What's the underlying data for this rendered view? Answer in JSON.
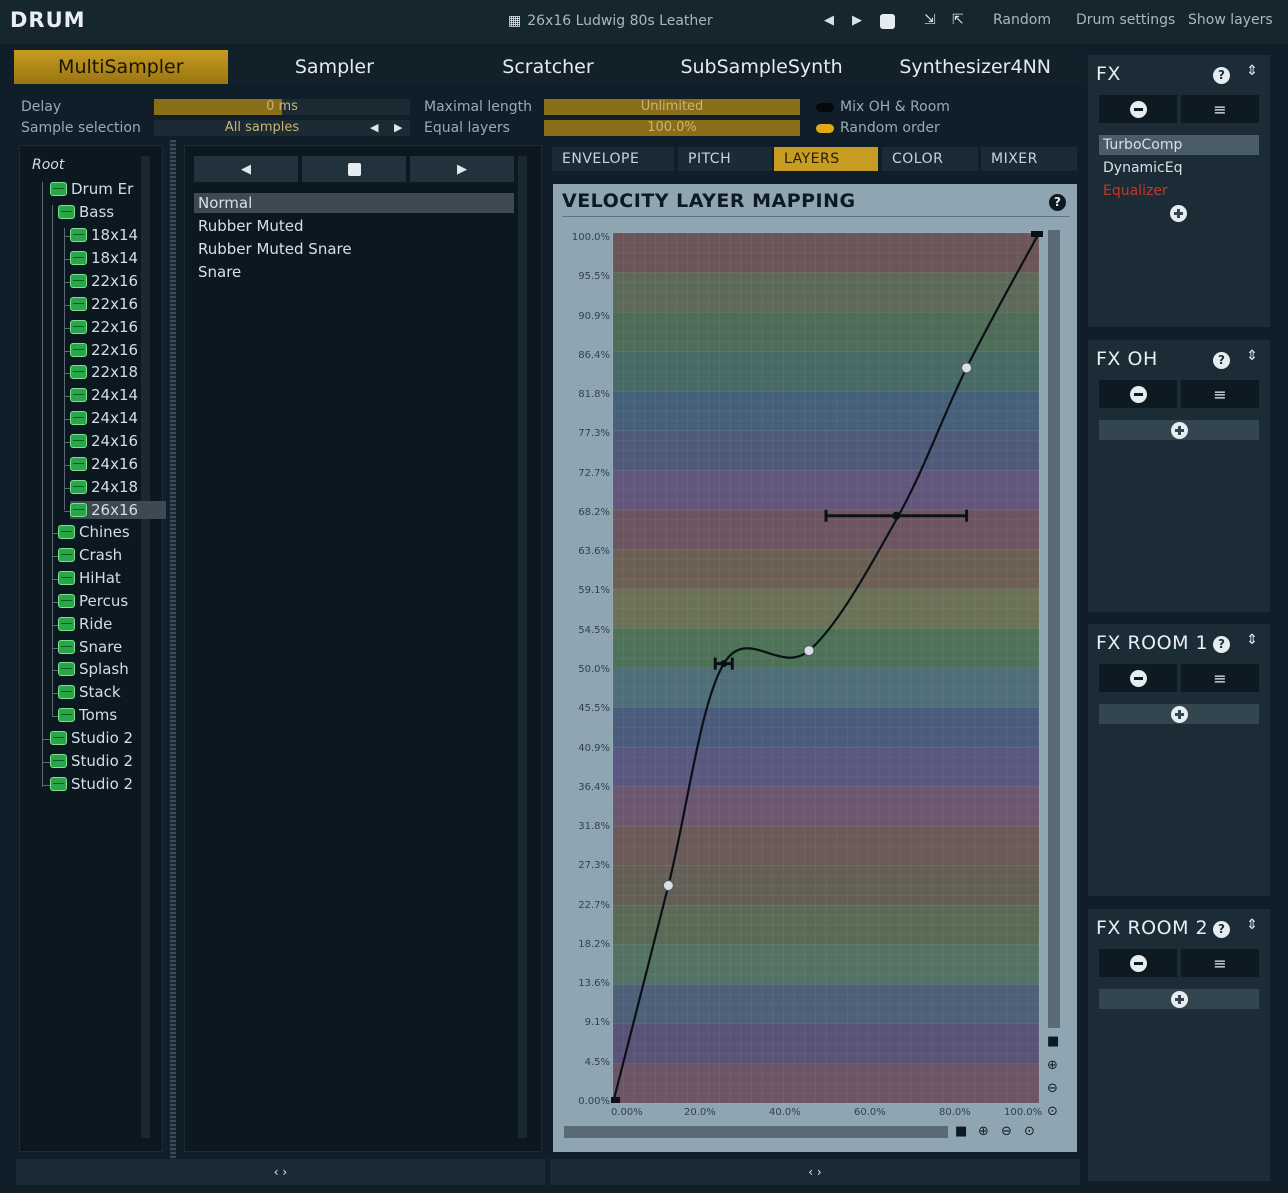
{
  "app_title": "DRUM",
  "topbar": {
    "preset_name": "26x16 Ludwig 80s Leather",
    "random_label": "Random",
    "drum_settings_label": "Drum settings",
    "show_layers_label": "Show layers"
  },
  "engine_tabs": [
    "MultiSampler",
    "Sampler",
    "Scratcher",
    "SubSampleSynth",
    "Synthesizer4NN"
  ],
  "params": {
    "delay_label": "Delay",
    "delay_value": "0 ms",
    "sample_selection_label": "Sample selection",
    "sample_selection_value": "All samples",
    "maximal_length_label": "Maximal length",
    "maximal_length_value": "Unlimited",
    "equal_layers_label": "Equal layers",
    "equal_layers_value": "100.0%",
    "mix_oh_room_label": "Mix OH & Room",
    "random_order_label": "Random order"
  },
  "tree": {
    "root": "Root",
    "drum_er": "Drum Er",
    "bass": "Bass",
    "bass_children": [
      "18x14",
      "18x14",
      "22x16",
      "22x16",
      "22x16",
      "22x16",
      "22x18",
      "24x14",
      "24x14",
      "24x16",
      "24x16",
      "24x18",
      "26x16"
    ],
    "groups": [
      "Chinese",
      "Crash",
      "HiHat",
      "Percus",
      "Ride",
      "Snare",
      "Splash",
      "Stack",
      "Toms"
    ],
    "studios": [
      "Studio 2",
      "Studio 2",
      "Studio 2"
    ]
  },
  "articulations": [
    "Normal",
    "Rubber Muted",
    "Rubber Muted Snare",
    "Snare"
  ],
  "sub_tabs": [
    "ENVELOPE",
    "PITCH",
    "LAYERS",
    "COLOR",
    "MIXER"
  ],
  "chart_title": "VELOCITY LAYER MAPPING",
  "chart_data": {
    "type": "line",
    "title": "VELOCITY LAYER MAPPING",
    "x_ticks": [
      "0.00%",
      "20.0%",
      "40.0%",
      "60.0%",
      "80.0%",
      "100.0%"
    ],
    "y_ticks": [
      "100.0%",
      "95.5%",
      "90.9%",
      "86.4%",
      "81.8%",
      "77.3%",
      "72.7%",
      "68.2%",
      "63.6%",
      "59.1%",
      "54.5%",
      "50.0%",
      "45.5%",
      "40.9%",
      "36.4%",
      "31.8%",
      "27.3%",
      "22.7%",
      "18.2%",
      "13.6%",
      "9.1%",
      "4.5%",
      "0.00%"
    ],
    "xlim": [
      0,
      100
    ],
    "ylim": [
      0,
      100
    ],
    "curve_points": [
      {
        "x": 0,
        "y": 0
      },
      {
        "x": 13,
        "y": 25
      },
      {
        "x": 26,
        "y": 50.5
      },
      {
        "x": 46,
        "y": 52
      },
      {
        "x": 67,
        "y": 67.5
      },
      {
        "x": 83,
        "y": 84.5
      },
      {
        "x": 100,
        "y": 100
      }
    ],
    "handle_points": [
      {
        "x": 13,
        "y": 25
      },
      {
        "x": 46,
        "y": 52
      },
      {
        "x": 83,
        "y": 84.5
      }
    ],
    "error_bar": {
      "y": 67.5,
      "x_min": 50,
      "x_max": 83
    },
    "small_bar": {
      "y": 50.5,
      "x_min": 24,
      "x_max": 28
    },
    "band_colors": [
      "#6b5558",
      "#5d6a59",
      "#4f6c58",
      "#476a67",
      "#46607a",
      "#4f5a7a",
      "#62567c",
      "#6c5560",
      "#6c5f54",
      "#6b7258",
      "#4e7257",
      "#4f6e77",
      "#4a5b7c",
      "#5a5780",
      "#6b5770",
      "#6c5a58",
      "#635f55",
      "#5b6a55",
      "#547263",
      "#4e5f78",
      "#595378",
      "#6b5566"
    ]
  },
  "fx_panels": [
    {
      "title": "FX",
      "items": [
        "TurboComp",
        "DynamicEq",
        "Equalizer"
      ]
    },
    {
      "title": "FX OH",
      "items": []
    },
    {
      "title": "FX ROOM 1",
      "items": []
    },
    {
      "title": "FX ROOM 2",
      "items": []
    }
  ],
  "bottom_toggle": "‹ ›",
  "colors": {
    "accent": "#c69c22",
    "disabled_fx": "#c0392b"
  }
}
